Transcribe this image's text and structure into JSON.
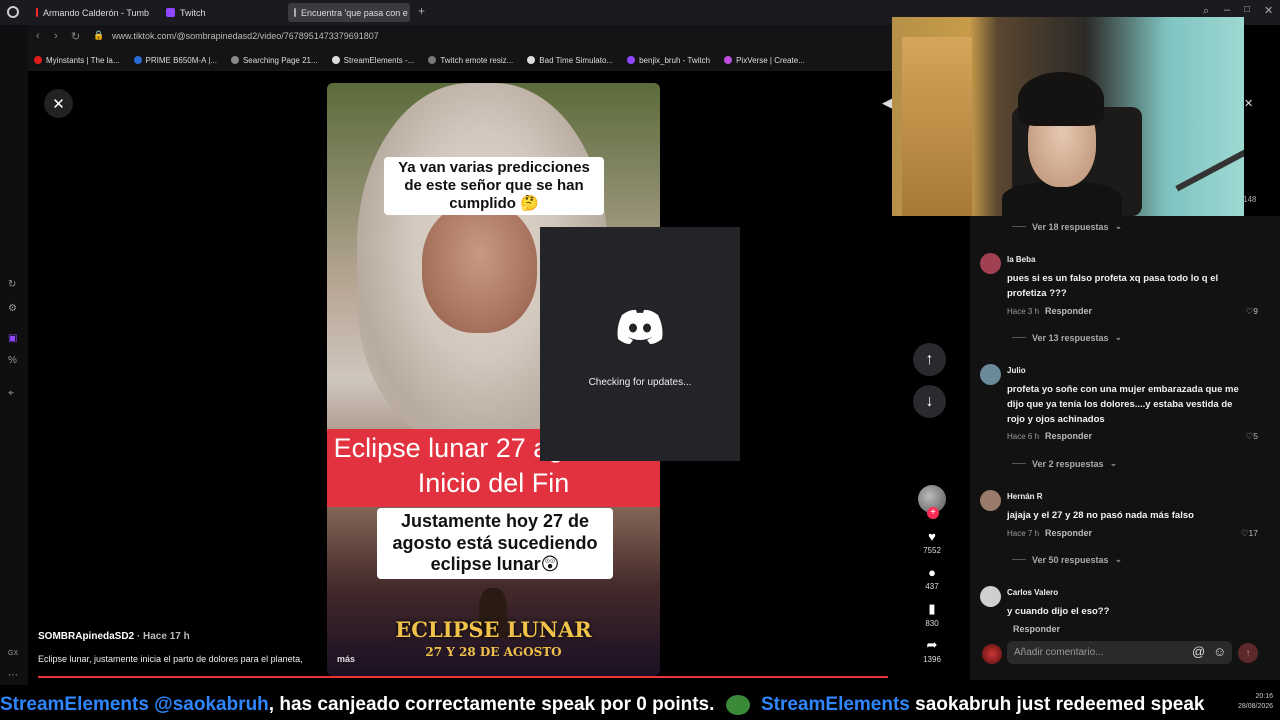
{
  "browser": {
    "tabs": [
      {
        "label": "Armando Calderón - Tumb",
        "color": "#ff2b2b"
      },
      {
        "label": "Twitch",
        "color": "#9146ff"
      },
      {
        "label": "Encuentra 'que pasa con e",
        "color": "#111111"
      }
    ],
    "new_tab": "+",
    "url": "www.tiktok.com/@sombrapinedasd2/video/7678951473379691807",
    "bookmarks": [
      {
        "label": "Myinstants | The la...",
        "color": "#e21d1d"
      },
      {
        "label": "PRIME B650M-A |...",
        "color": "#2a6bd6"
      },
      {
        "label": "Searching Page 21...",
        "color": "#888888"
      },
      {
        "label": "StreamElements -...",
        "color": "#dddddd"
      },
      {
        "label": "Twitch emote resiz...",
        "color": "#777777"
      },
      {
        "label": "Bad Time Simulato...",
        "color": "#dddddd"
      },
      {
        "label": "benjix_bruh - Twitch",
        "color": "#9146ff"
      },
      {
        "label": "PixVerse | Create...",
        "color": "#c04dd9"
      }
    ]
  },
  "video": {
    "caption_top": "Ya van varias predicciones de este señor que se han cumplido 🤔",
    "banner": "Eclipse lunar 27 agosto, El Inicio del Fin",
    "caption_bottom": "Justamente hoy 27 de agosto está sucediendo eclipse lunar😲",
    "poster_title": "ECLIPSE LUNAR",
    "poster_sub": "27 Y 28 DE AGOSTO"
  },
  "discord": {
    "status": "Checking for updates..."
  },
  "actions": {
    "likes": "7552",
    "comments": "437",
    "saves": "830",
    "shares": "1396"
  },
  "author": {
    "name": "SOMBRApinedaSD2",
    "time": "· Hace 17 h",
    "description": "Eclipse lunar, justamente inicia el parto de dolores para el planeta,",
    "more": "más"
  },
  "comments_panel": {
    "edge_count": "148",
    "top_replies": "Ver 18 respuestas",
    "items": [
      {
        "user": "la Beba",
        "text": "pues si es un falso profeta xq pasa todo lo q el profetiza ???",
        "time": "Hace 3 h",
        "reply": "Responder",
        "likes": "9",
        "replies": "Ver 13 respuestas",
        "avatar": "#a04050"
      },
      {
        "user": "Julio",
        "text": "profeta yo soñe con una mujer embarazada que me dijo que ya tenía los dolores....y estaba vestida de rojo y ojos achinados",
        "time": "Hace 6 h",
        "reply": "Responder",
        "likes": "5",
        "replies": "Ver 2 respuestas",
        "avatar": "#6a8a9a"
      },
      {
        "user": "Hernán R",
        "text": "jajaja y el 27 y 28 no pasó nada más falso",
        "time": "Hace 7 h",
        "reply": "Responder",
        "likes": "17",
        "replies": "Ver 50 respuestas",
        "avatar": "#9a7a6a"
      },
      {
        "user": "Carlos Valero",
        "text": "y cuando dijo el eso??",
        "time": "",
        "reply": "Responder",
        "likes": "",
        "replies": "",
        "avatar": "#cfcfcf"
      }
    ],
    "input_placeholder": "Añadir comentario..."
  },
  "ticker": {
    "part1": "StreamElements @saokabruh",
    "part2": ", has canjeado correctamente speak por 0 points.",
    "part3": "StreamElements",
    "part4": " saokabruh just redeemed speak"
  },
  "clock": {
    "time": "20:16",
    "date": "28/08/2026",
    "lang": "ESP"
  }
}
